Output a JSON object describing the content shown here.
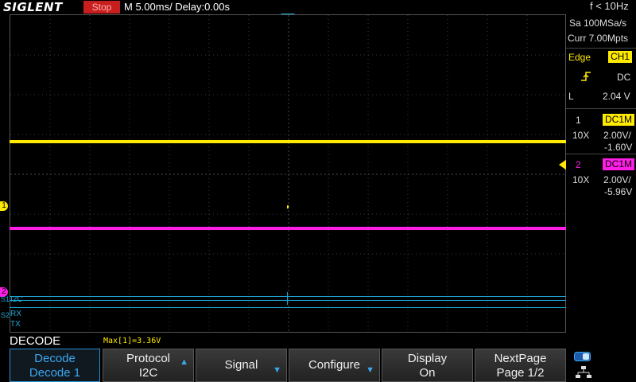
{
  "topbar": {
    "brand": "SIGLENT",
    "run_state": "Stop",
    "timebase": "M 5.00ms/ Delay:0.00s",
    "frequency": "f < 10Hz"
  },
  "acquisition": {
    "sample_rate": "Sa 100MSa/s",
    "memory": "Curr 7.00Mpts"
  },
  "trigger": {
    "type": "Edge",
    "source": "CH1",
    "slope_icon": "rising-edge-icon",
    "coupling": "DC",
    "level_label": "L",
    "level": "2.04 V"
  },
  "channels": [
    {
      "number": "1",
      "coupling": "DC1M",
      "probe": "10X",
      "scale": "2.00V/",
      "offset": "-1.60V",
      "color": "#ffea00"
    },
    {
      "number": "2",
      "coupling": "DC1M",
      "probe": "10X",
      "scale": "2.00V/",
      "offset": "-5.96V",
      "color": "#ff1ee6"
    }
  ],
  "serial_bus": {
    "s1_marker": "S1",
    "s1_label": "I2C",
    "s2_marker": "S2",
    "s2_rx": "RX",
    "s2_tx": "TX",
    "color": "#1ea8d8"
  },
  "waveform_markers": {
    "ch1_marker": "1",
    "ch2_marker": "2"
  },
  "menu": {
    "title": "DECODE",
    "measurement": "Max[1]=3.36V",
    "softkeys": [
      {
        "line1": "Decode",
        "line2": "Decode 1",
        "active": true
      },
      {
        "line1": "Protocol",
        "line2": "I2C"
      },
      {
        "line1": "Signal",
        "line2": ""
      },
      {
        "line1": "Configure",
        "line2": ""
      },
      {
        "line1": "Display",
        "line2": "On"
      },
      {
        "line1": "NextPage",
        "line2": "Page 1/2"
      }
    ]
  }
}
